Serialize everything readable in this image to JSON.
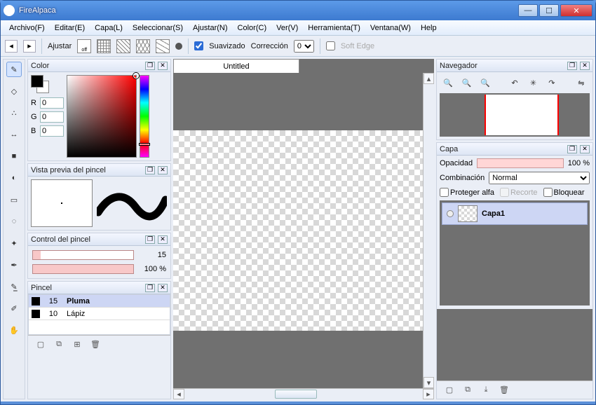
{
  "window": {
    "title": "FireAlpaca"
  },
  "menu": [
    "Archivo(F)",
    "Editar(E)",
    "Capa(L)",
    "Seleccionar(S)",
    "Ajustar(N)",
    "Color(C)",
    "Ver(V)",
    "Herramienta(T)",
    "Ventana(W)",
    "Help"
  ],
  "options": {
    "adjust_label": "Ajustar",
    "swatch_off": "off",
    "smoothing_label": "Suavizado",
    "smoothing_checked": true,
    "correction_label": "Corrección",
    "correction_value": "0",
    "softedge_label": "Soft Edge",
    "softedge_checked": false
  },
  "panels": {
    "color": {
      "title": "Color",
      "r_label": "R",
      "r_value": "0",
      "g_label": "G",
      "g_value": "0",
      "b_label": "B",
      "b_value": "0"
    },
    "brush_preview": {
      "title": "Vista previa del pincel"
    },
    "brush_control": {
      "title": "Control del pincel",
      "size_value": "15",
      "opacity_value": "100 %",
      "size_fill_pct": 8,
      "opacity_fill_pct": 100
    },
    "brush_list": {
      "title": "Pincel",
      "items": [
        {
          "swatch": true,
          "size": "15",
          "name": "Pluma",
          "selected": true
        },
        {
          "swatch": true,
          "size": "10",
          "name": "Lápiz",
          "selected": false
        }
      ]
    },
    "navigator": {
      "title": "Navegador"
    },
    "layer": {
      "title": "Capa",
      "opacity_label": "Opacidad",
      "opacity_value": "100 %",
      "blend_label": "Combinación",
      "blend_value": "Normal",
      "protect_label": "Proteger alfa",
      "clip_label": "Recorte",
      "lock_label": "Bloquear",
      "items": [
        {
          "name": "Capa1"
        }
      ]
    }
  },
  "document": {
    "tab_title": "Untitled"
  }
}
